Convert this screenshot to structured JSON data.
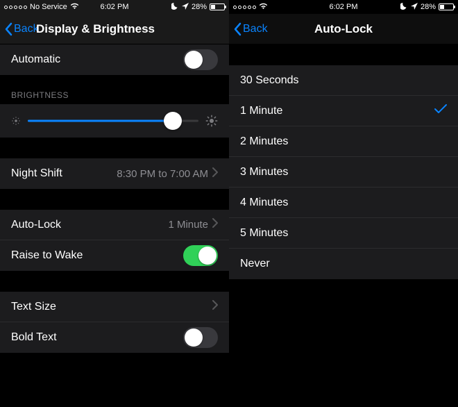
{
  "status": {
    "carrier": "No Service",
    "time": "6:02 PM",
    "battery_pct": "28%"
  },
  "left": {
    "nav_back": "Back",
    "nav_title": "Display & Brightness",
    "automatic_label": "Automatic",
    "brightness_header": "BRIGHTNESS",
    "brightness_pct": 85,
    "night_shift_label": "Night Shift",
    "night_shift_value": "8:30 PM to 7:00 AM",
    "auto_lock_label": "Auto-Lock",
    "auto_lock_value": "1 Minute",
    "raise_to_wake_label": "Raise to Wake",
    "text_size_label": "Text Size",
    "bold_text_label": "Bold Text",
    "toggles": {
      "automatic": false,
      "raise_to_wake": true,
      "bold_text": false
    }
  },
  "right": {
    "nav_back": "Back",
    "nav_title": "Auto-Lock",
    "options": [
      {
        "label": "30 Seconds",
        "selected": false
      },
      {
        "label": "1 Minute",
        "selected": true
      },
      {
        "label": "2 Minutes",
        "selected": false
      },
      {
        "label": "3 Minutes",
        "selected": false
      },
      {
        "label": "4 Minutes",
        "selected": false
      },
      {
        "label": "5 Minutes",
        "selected": false
      },
      {
        "label": "Never",
        "selected": false
      }
    ]
  },
  "colors": {
    "accent": "#0a84ff",
    "toggle_on": "#30d158",
    "bg": "#000000",
    "cell": "#1c1c1e"
  }
}
